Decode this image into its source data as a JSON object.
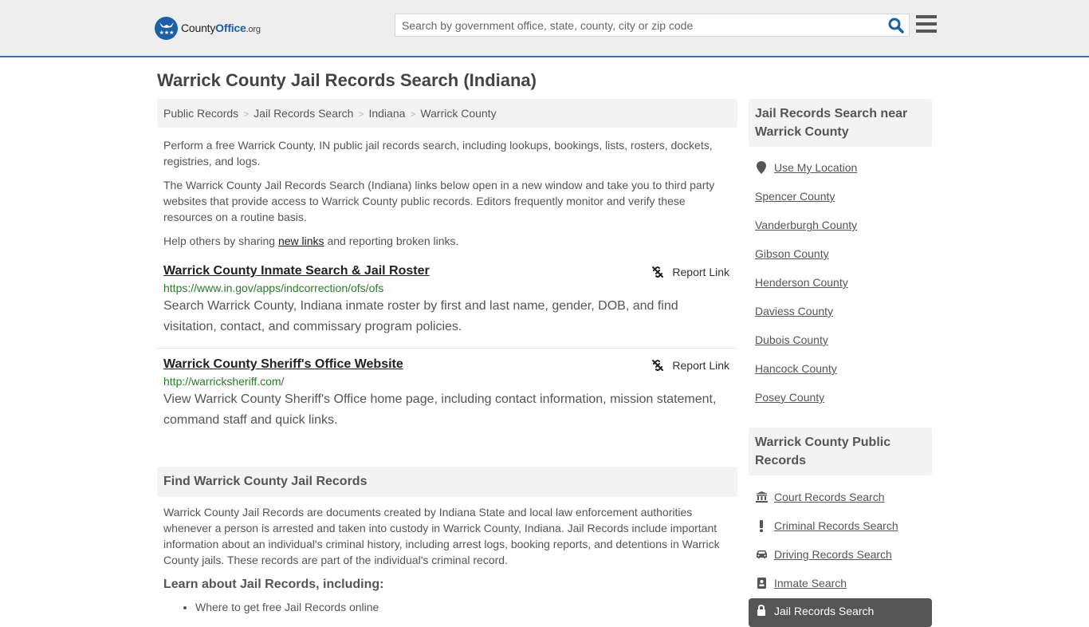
{
  "header": {
    "logo": {
      "county": "County",
      "office": "Office",
      "org": ".org"
    },
    "search": {
      "placeholder": "Search by government office, state, county, city or zip code",
      "value": ""
    },
    "icons": {
      "search": "search-icon",
      "menu": "hamburger-menu-icon"
    }
  },
  "page": {
    "title": "Warrick County Jail Records Search (Indiana)",
    "breadcrumb": [
      "Public Records",
      "Jail Records Search",
      "Indiana",
      "Warrick County"
    ],
    "intro": {
      "p1": "Perform a free Warrick County, IN public jail records search, including lookups, bookings, lists, rosters, dockets, registries, and logs.",
      "p2": "The Warrick County Jail Records Search (Indiana) links below open in a new window and take you to third party websites that provide access to Warrick County public records. Editors frequently monitor and verify these resources on a routine basis.",
      "p3_before": "Help others by sharing ",
      "p3_link": "new links",
      "p3_after": " and reporting broken links."
    },
    "entries": [
      {
        "title": "Warrick County Inmate Search & Jail Roster",
        "url": "https://www.in.gov/apps/indcorrection/ofs/ofs",
        "description": "Search Warrick County, Indiana inmate roster by first and last name, gender, DOB, and find visitation, contact, and commissary program policies.",
        "report_label": "Report Link"
      },
      {
        "title": "Warrick County Sheriff's Office Website",
        "url": "http://warricksheriff.com/",
        "description": "View Warrick County Sheriff's Office home page, including contact information, mission statement, command staff and quick links.",
        "report_label": "Report Link"
      }
    ],
    "find_section": {
      "heading": "Find Warrick County Jail Records",
      "body": "Warrick County Jail Records are documents created by Indiana State and local law enforcement authorities whenever a person is arrested and taken into custody in Warrick County, Indiana. Jail Records include important information about an individual's criminal history, including arrest logs, booking reports, and detentions in Warrick County jails. These records are part of the individual's criminal record.",
      "learn_heading": "Learn about Jail Records, including:",
      "learn_items": [
        "Where to get free Jail Records online"
      ]
    }
  },
  "sidebar": {
    "nearby": {
      "heading": "Jail Records Search near Warrick County",
      "use_location": "Use My Location",
      "counties": [
        "Spencer County",
        "Vanderburgh County",
        "Gibson County",
        "Henderson County",
        "Daviess County",
        "Dubois County",
        "Hancock County",
        "Posey County"
      ]
    },
    "public_records": {
      "heading": "Warrick County Public Records",
      "items": [
        {
          "label": "Court Records Search",
          "icon": "courthouse-icon"
        },
        {
          "label": "Criminal Records Search",
          "icon": "exclamation-icon"
        },
        {
          "label": "Driving Records Search",
          "icon": "car-icon"
        },
        {
          "label": "Inmate Search",
          "icon": "id-badge-icon"
        }
      ],
      "active": {
        "label": "Jail Records Search",
        "icon": "lock-icon"
      }
    }
  }
}
